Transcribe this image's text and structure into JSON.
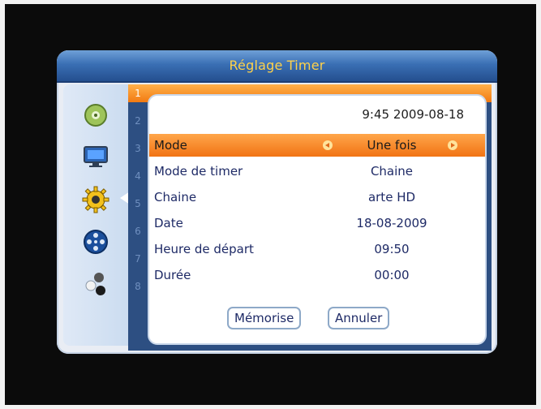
{
  "window": {
    "title": "Réglage Timer"
  },
  "timer_slots": [
    "1",
    "2",
    "3",
    "4",
    "5",
    "6",
    "7",
    "8"
  ],
  "dialog": {
    "datetime": "9:45 2009-08-18",
    "fields": [
      {
        "label": "Mode",
        "value": "Une fois",
        "selected": true
      },
      {
        "label": "Mode de timer",
        "value": "Chaine",
        "selected": false
      },
      {
        "label": "Chaine",
        "value": "arte HD",
        "selected": false
      },
      {
        "label": "Date",
        "value": "18-08-2009",
        "selected": false
      },
      {
        "label": "Heure de départ",
        "value": "09:50",
        "selected": false
      },
      {
        "label": "Durée",
        "value": "00:00",
        "selected": false
      }
    ],
    "buttons": {
      "save": "Mémorise",
      "cancel": "Annuler"
    }
  },
  "sidebar_icons": [
    "satellite-dish-icon",
    "tv-icon",
    "gear-icon",
    "film-reel-icon",
    "connect-icon"
  ],
  "colors": {
    "title_text": "#ffd24a",
    "highlight": "#f17314"
  }
}
